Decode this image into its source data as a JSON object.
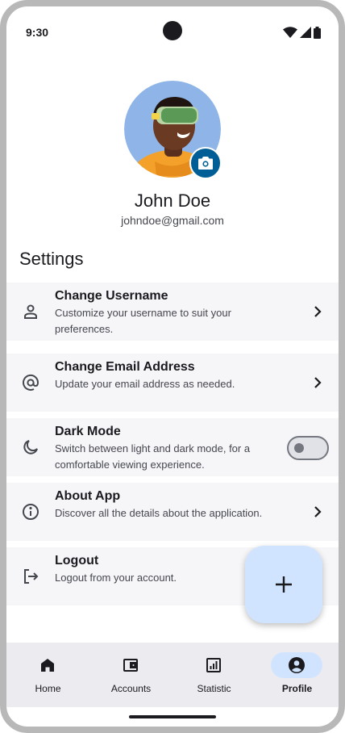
{
  "status_bar": {
    "time": "9:30"
  },
  "profile": {
    "name": "John Doe",
    "email": "johndoe@gmail.com"
  },
  "settings": {
    "title": "Settings",
    "items": [
      {
        "title": "Change Username",
        "description": "Customize your username to suit your preferences.",
        "icon": "person-icon",
        "trailing": "chevron"
      },
      {
        "title": "Change Email Address",
        "description": "Update your email address as needed.",
        "icon": "at-sign-icon",
        "trailing": "chevron"
      },
      {
        "title": "Dark Mode",
        "description": "Switch between light and dark mode, for a comfortable viewing experience.",
        "icon": "moon-icon",
        "trailing": "toggle",
        "toggle_on": false
      },
      {
        "title": "About App",
        "description": "Discover all the details about the application.",
        "icon": "info-icon",
        "trailing": "chevron"
      },
      {
        "title": "Logout",
        "description": "Logout from your account.",
        "icon": "logout-icon",
        "trailing": "none"
      }
    ]
  },
  "fab": {
    "icon": "plus-icon"
  },
  "bottom_nav": {
    "items": [
      {
        "label": "Home",
        "icon": "home-icon",
        "active": false
      },
      {
        "label": "Accounts",
        "icon": "wallet-icon",
        "active": false
      },
      {
        "label": "Statistic",
        "icon": "statistic-icon",
        "active": false
      },
      {
        "label": "Profile",
        "icon": "account-circle-icon",
        "active": true
      }
    ]
  },
  "colors": {
    "primary": "#005e97",
    "primary_container": "#d1e4ff",
    "surface_container": "#f6f6f9",
    "nav_background": "#ebebf0"
  }
}
